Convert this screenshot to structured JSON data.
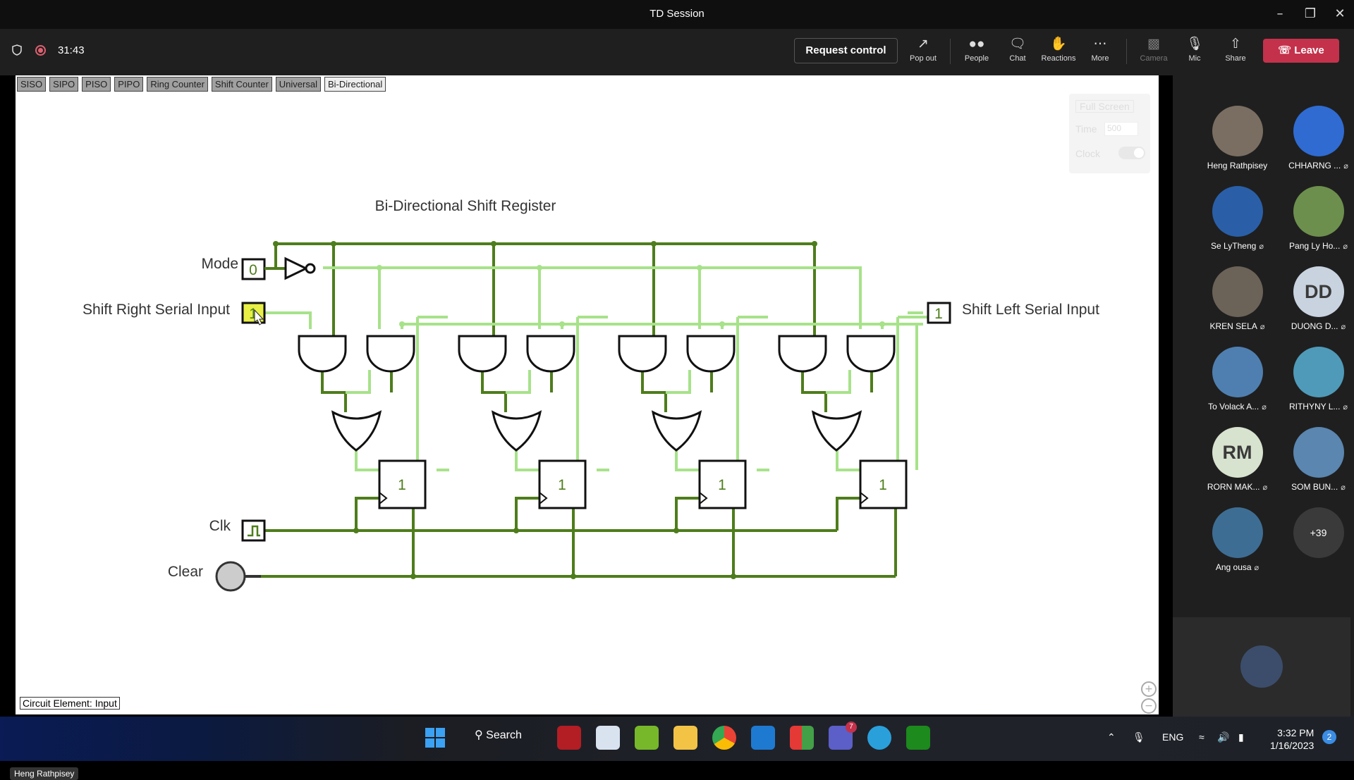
{
  "window": {
    "title": "TD Session"
  },
  "toolbar": {
    "timer": "31:43",
    "request_control": "Request control",
    "items": [
      {
        "label": "Pop out",
        "icon": "pop-out-icon"
      },
      {
        "label": "People",
        "icon": "people-icon"
      },
      {
        "label": "Chat",
        "icon": "chat-icon"
      },
      {
        "label": "Reactions",
        "icon": "reactions-icon"
      },
      {
        "label": "More",
        "icon": "more-icon"
      },
      {
        "label": "Camera",
        "icon": "camera-off-icon"
      },
      {
        "label": "Mic",
        "icon": "mic-off-icon"
      },
      {
        "label": "Share",
        "icon": "share-icon"
      }
    ],
    "leave": "Leave"
  },
  "simulator": {
    "tabs": [
      "SISO",
      "SIPO",
      "PISO",
      "PIPO",
      "Ring Counter",
      "Shift Counter",
      "Universal",
      "Bi-Directional"
    ],
    "active_tab": "Bi-Directional",
    "controls": {
      "fullscreen": "Full Screen",
      "time_label": "Time",
      "time_value": "500",
      "clock_label": "Clock"
    },
    "circuit": {
      "title": "Bi-Directional Shift Register",
      "mode_label": "Mode",
      "mode_value": "0",
      "sr_label": "Shift Right Serial Input",
      "sr_value": "1",
      "sl_label": "Shift Left Serial Input",
      "sl_value": "1",
      "clk_label": "Clk",
      "clear_label": "Clear",
      "ff_values": [
        "1",
        "1",
        "1",
        "1"
      ]
    },
    "status": "Circuit Element: Input",
    "presenter_tag": "Heng Rathpisey"
  },
  "participants": [
    {
      "name": "Heng Rathpisey",
      "muted": false,
      "initials": "",
      "bg": "#7a6e62"
    },
    {
      "name": "CHHARNG ...",
      "muted": true,
      "initials": "",
      "bg": "#2f6bd1"
    },
    {
      "name": "Se LyTheng",
      "muted": true,
      "initials": "",
      "bg": "#2a5fa8"
    },
    {
      "name": "Pang Ly Ho...",
      "muted": true,
      "initials": "",
      "bg": "#6d8f4d"
    },
    {
      "name": "KREN SELA",
      "muted": true,
      "initials": "",
      "bg": "#6b6258"
    },
    {
      "name": "DUONG D...",
      "muted": true,
      "initials": "DD",
      "bg": "#c9d3e0"
    },
    {
      "name": "To Volack A...",
      "muted": true,
      "initials": "",
      "bg": "#4f7fb0"
    },
    {
      "name": "RITHYNY L...",
      "muted": true,
      "initials": "",
      "bg": "#4f9ab8"
    },
    {
      "name": "RORN MAK...",
      "muted": true,
      "initials": "RM",
      "bg": "#d7e2cf"
    },
    {
      "name": "SOM BUN...",
      "muted": true,
      "initials": "",
      "bg": "#5a86b0"
    },
    {
      "name": "Ang ousa",
      "muted": true,
      "initials": "",
      "bg": "#3e6d93"
    }
  ],
  "more_count": "+39",
  "taskbar": {
    "search": "Search",
    "lang": "ENG",
    "time": "3:32 PM",
    "date": "1/16/2023",
    "teams_badge": "7",
    "notif_count": "2"
  }
}
